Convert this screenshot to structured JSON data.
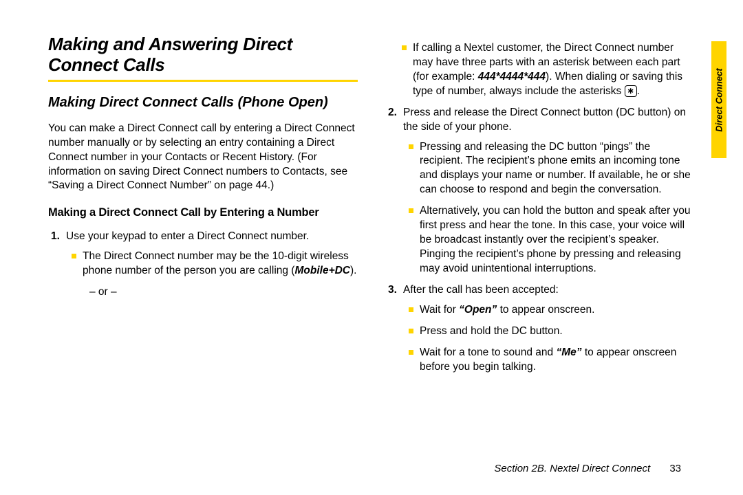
{
  "sidetab": {
    "label": "Direct Connect"
  },
  "title": "Making and Answering Direct Connect Calls",
  "subheading": "Making Direct Connect Calls (Phone Open)",
  "intro": "You can make a Direct Connect call by entering a Direct Connect number manually or by selecting an entry containing a Direct Connect number in your Contacts or Recent History. (For information on saving Direct Connect numbers to Contacts, see “Saving a Direct Connect Number” on page 44.)",
  "subsub": "Making a Direct Connect Call by Entering a Number",
  "left": {
    "step1_num": "1.",
    "step1_text": "Use your keypad to enter a Direct Connect number.",
    "sub1_prefix": "The Direct Connect number may be the 10-digit wireless phone number of the person you are calling (",
    "sub1_bold": "Mobile+DC",
    "sub1_suffix": ").",
    "or": "– or –"
  },
  "right": {
    "sub2_prefix": "If calling a Nextel customer, the Direct Connect number may have three parts with an asterisk between each part (for example: ",
    "sub2_example": "444*4444*444",
    "sub2_mid": "). When dialing or saving this type of number, always include the asterisks ",
    "sub2_keycap": "∗",
    "sub2_suffix": ".",
    "step2_num": "2.",
    "step2_text": "Press and release the Direct Connect button (DC button) on the side of your phone.",
    "step2_sub1": "Pressing and releasing the DC button “pings” the recipient. The recipient’s phone emits an incoming tone and displays your name or number. If available, he or she can choose to respond and begin the conversation.",
    "step2_sub2": "Alternatively, you can hold the button and speak after you first press and hear the tone. In this case, your voice will be broadcast instantly over the recipient’s speaker. Pinging the recipient’s phone by pressing and releasing may avoid unintentional interruptions.",
    "step3_num": "3.",
    "step3_text": "After the call has been accepted:",
    "step3_sub1_pre": "Wait for ",
    "step3_sub1_q": "“Open”",
    "step3_sub1_post": " to appear onscreen.",
    "step3_sub2": "Press and hold the DC button.",
    "step3_sub3_pre": "Wait for a tone to sound and ",
    "step3_sub3_q": "“Me”",
    "step3_sub3_post": " to appear onscreen before you begin talking."
  },
  "footer": {
    "section": "Section 2B. Nextel Direct Connect",
    "page": "33"
  }
}
